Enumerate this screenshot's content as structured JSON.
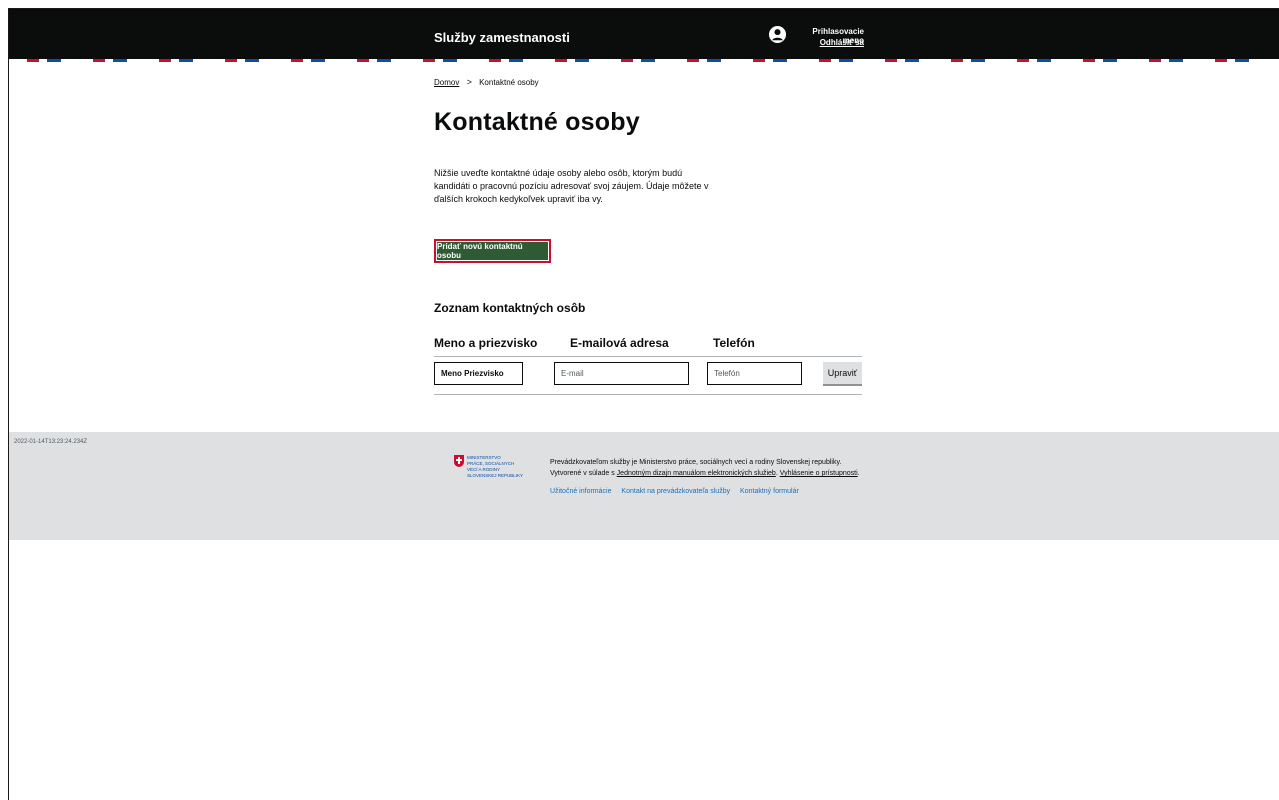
{
  "header": {
    "service_name": "Služby zamestnanosti",
    "login_name": "Prihlasovacie meno",
    "logout": "Odhlásiť sa"
  },
  "breadcrumb": {
    "home": "Domov",
    "separator": ">",
    "current": "Kontaktné osoby"
  },
  "page": {
    "title": "Kontaktné osoby",
    "intro": "Nižšie uveďte kontaktné údaje osoby alebo osôb, ktorým budú kandidáti o pracovnú pozíciu adresovať svoj záujem. Údaje môžete v ďalších krokoch kedykoľvek upraviť iba vy.",
    "add_button": "Pridať novú kontaktnú osobu",
    "list_title": "Zoznam kontaktných osôb"
  },
  "table": {
    "columns": [
      "Meno a priezvisko",
      "E-mailová adresa",
      "Telefón"
    ],
    "rows": [
      {
        "name": "Meno Priezvisko",
        "email_placeholder": "E-mail",
        "phone_placeholder": "Telefón",
        "edit": "Upraviť"
      }
    ]
  },
  "timestamp": "2022-01-14T13:23:24.234Z",
  "footer": {
    "logo_lines": [
      "MINISTERSTVO",
      "PRÁCE, SOCIÁLNYCH",
      "VECÍ A RODINY",
      "SLOVENSKEJ REPUBLIKY"
    ],
    "text_part1": "Prevádzkovateľom služby je Ministerstvo práce, sociálnych vecí a rodiny Slovenskej republiky. Vytvorené v súlade s ",
    "text_link1": "Jednotným dizajn manuálom elektronických služieb",
    "text_part2": ". ",
    "text_link2": "Vyhlásenie o prístupnosti",
    "text_part3": ".",
    "links": [
      "Užitočné informácie",
      "Kontakt na prevádzkovateľa služby",
      "Kontaktný formulár"
    ]
  },
  "colors": {
    "header_bg": "#0b0c0c",
    "primary_button": "#2e5b33",
    "focus_border": "#c8102e",
    "footer_bg": "#dee0e2",
    "link": "#1d70b8"
  }
}
